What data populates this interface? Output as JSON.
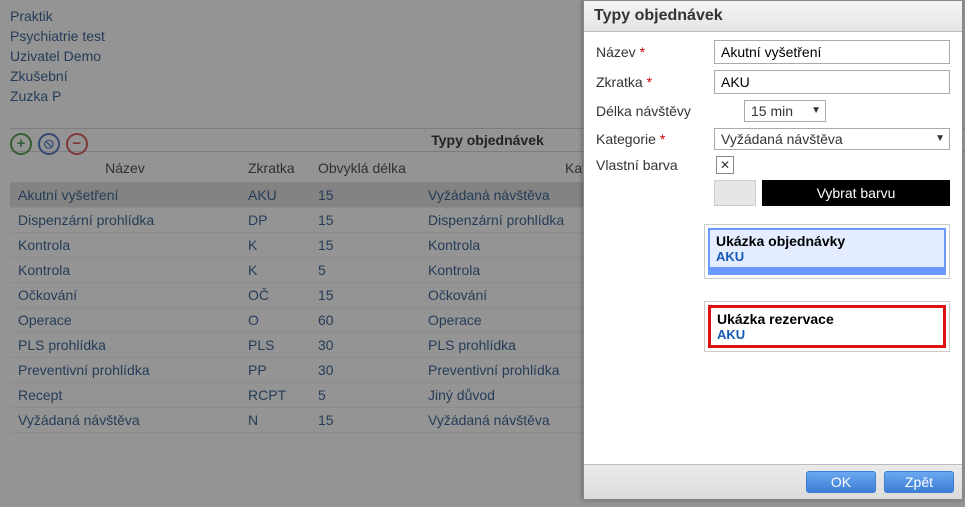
{
  "sidebar": {
    "items": [
      {
        "label": "Praktik"
      },
      {
        "label": "Psychiatrie test"
      },
      {
        "label": "Uzivatel Demo"
      },
      {
        "label": "Zkušební"
      },
      {
        "label": "Zuzka P"
      }
    ]
  },
  "toolbar": {
    "title": "Typy objednávek"
  },
  "table": {
    "headers": [
      "Název",
      "Zkratka",
      "Obvyklá délka",
      "Kategorie"
    ],
    "rows": [
      {
        "nazev": "Akutní vyšetření",
        "zkratka": "AKU",
        "delka": "15",
        "kategorie": "Vyžádaná návštěva",
        "selected": true
      },
      {
        "nazev": "Dispenzární prohlídka",
        "zkratka": "DP",
        "delka": "15",
        "kategorie": "Dispenzární prohlídka"
      },
      {
        "nazev": "Kontrola",
        "zkratka": "K",
        "delka": "15",
        "kategorie": "Kontrola"
      },
      {
        "nazev": "Kontrola",
        "zkratka": "K",
        "delka": "5",
        "kategorie": "Kontrola"
      },
      {
        "nazev": "Očkování",
        "zkratka": "OČ",
        "delka": "15",
        "kategorie": "Očkování"
      },
      {
        "nazev": "Operace",
        "zkratka": "O",
        "delka": "60",
        "kategorie": "Operace"
      },
      {
        "nazev": "PLS prohlídka",
        "zkratka": "PLS",
        "delka": "30",
        "kategorie": "PLS prohlídka"
      },
      {
        "nazev": "Preventivní prohlídka",
        "zkratka": "PP",
        "delka": "30",
        "kategorie": "Preventivní prohlídka"
      },
      {
        "nazev": "Recept",
        "zkratka": "RCPT",
        "delka": "5",
        "kategorie": "Jiný důvod"
      },
      {
        "nazev": "Vyžádaná návštěva",
        "zkratka": "N",
        "delka": "15",
        "kategorie": "Vyžádaná návštěva"
      }
    ]
  },
  "dialog": {
    "title": "Typy objednávek",
    "labels": {
      "nazev": "Název",
      "zkratka": "Zkratka",
      "delka": "Délka návštěvy",
      "kategorie": "Kategorie",
      "barva": "Vlastní barva"
    },
    "values": {
      "nazev": "Akutní vyšetření",
      "zkratka": "AKU",
      "delka": "15 min",
      "kategorie": "Vyžádaná návštěva"
    },
    "clear_mark": "✕",
    "color_btn": "Vybrat barvu",
    "preview1_title": "Ukázka objednávky",
    "preview1_sub": "AKU",
    "preview2_title": "Ukázka rezervace",
    "preview2_sub": "AKU",
    "ok": "OK",
    "back": "Zpět"
  }
}
